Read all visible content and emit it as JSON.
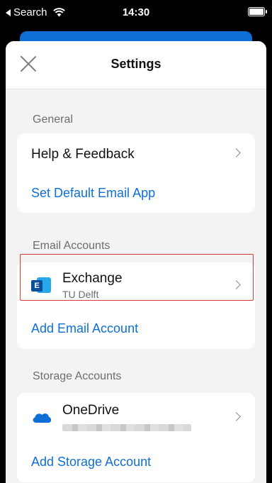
{
  "status_bar": {
    "back_label": "Search",
    "time": "14:30"
  },
  "header": {
    "title": "Settings"
  },
  "sections": {
    "general": {
      "label": "General",
      "help": "Help & Feedback",
      "default_app": "Set Default Email App"
    },
    "email": {
      "label": "Email Accounts",
      "account_name": "Exchange",
      "account_org": "TU Delft",
      "add": "Add Email Account",
      "icon_letter": "E"
    },
    "storage": {
      "label": "Storage Accounts",
      "account_name": "OneDrive",
      "add": "Add Storage Account"
    }
  },
  "colors": {
    "accent": "#0f6fd6",
    "highlight": "#d63b3b"
  },
  "icons": [
    "back-triangle-icon",
    "wifi-icon",
    "battery-icon",
    "close-icon",
    "chevron-right-icon",
    "exchange-icon",
    "onedrive-icon"
  ]
}
